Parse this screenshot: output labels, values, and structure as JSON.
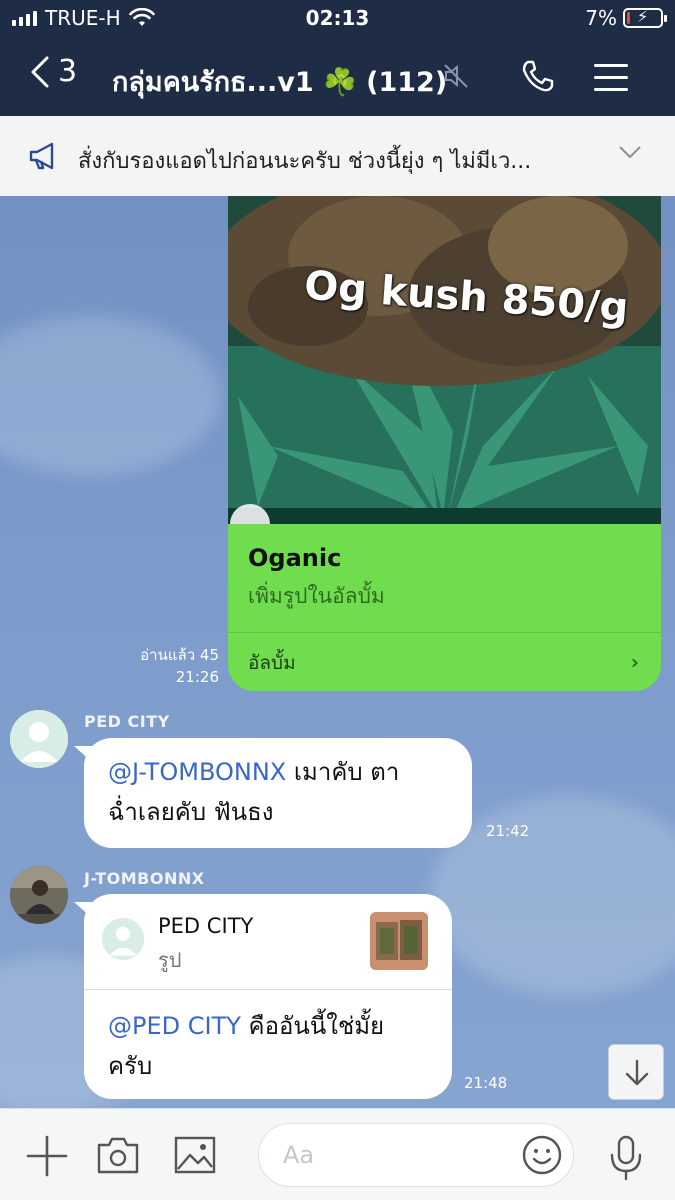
{
  "status_bar": {
    "carrier": "TRUE-H",
    "time": "02:13",
    "battery_percent": "7%",
    "battery_level": 0.07
  },
  "header": {
    "back_count": "3",
    "title": "กลุ่มคนรักธ...v1 ☘️ (112)"
  },
  "announcement": {
    "text": "สั่งกับรองแอดไปก่อนนะครับ ช่วงนี้ยุ่ง ๆ ไม่มีเว..."
  },
  "album": {
    "photo_text": "Og kush 850/g",
    "name": "Oganic",
    "subtitle": "เพิ่มรูปในอัลบั้ม",
    "footer_label": "อัลบั้ม",
    "read_count": "อ่านแล้ว 45",
    "time": "21:26"
  },
  "messages": [
    {
      "sender": "PED CITY",
      "mention": "@J-TOMBONNX",
      "text_line1": " เมาคับ ตา",
      "text_line2": "ฉ่ำเลยคับ ฟันธง",
      "time": "21:42"
    },
    {
      "sender": "J-TOMBONNX",
      "reply_to_name": "PED CITY",
      "reply_to_type": "รูป",
      "mention": "@PED CITY",
      "text_line1": "  คืออันนี้ใช่มั้ย",
      "text_line2": "ครับ",
      "time": "21:48"
    }
  ],
  "composer": {
    "placeholder": "Aa"
  },
  "colors": {
    "header_bg": "#1f2c45",
    "album_green": "#6fdd4e",
    "mention_blue": "#3a66c8",
    "chat_bg": "#7795c2"
  }
}
